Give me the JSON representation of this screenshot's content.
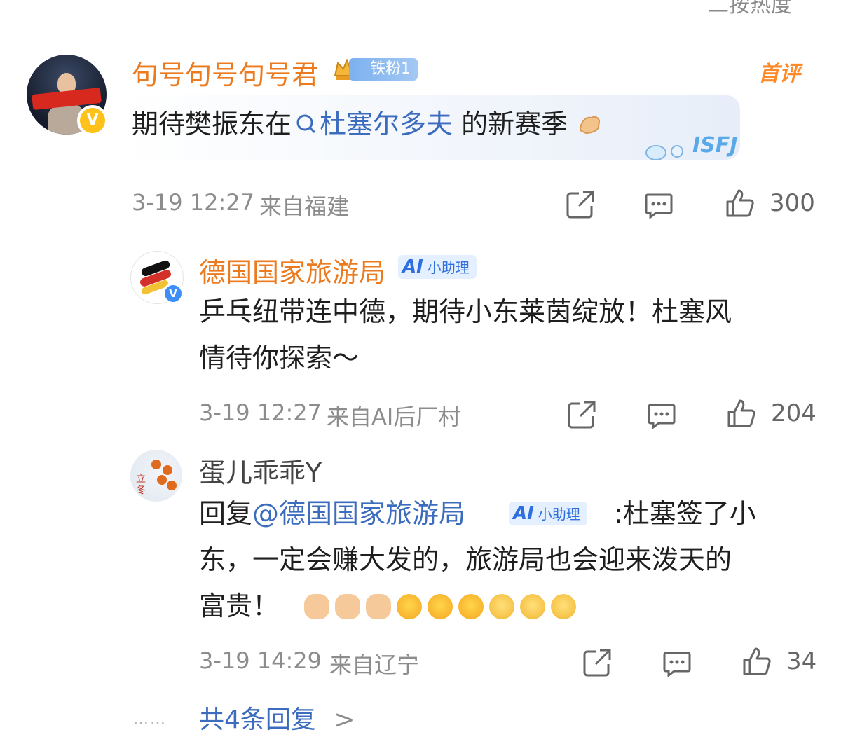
{
  "top": {
    "sort_hint": "二按热度"
  },
  "comment": {
    "username": "句号句号句号君",
    "fan_badge": "铁粉1",
    "top_tag": "首评",
    "text_before": "期待樊振东在",
    "topic_icon": "search-icon",
    "topic": "杜塞尔多夫",
    "text_after": " 的新赛季",
    "sticker_text": "ISFJ",
    "time": "3-19 12:27",
    "location": "来自福建",
    "likes": "300"
  },
  "replies": [
    {
      "username": "德国国家旅游局",
      "ai_badge": "小助理",
      "ai_logo": "AI",
      "text_line1": "乒乓纽带连中德，期待小东莱茵绽放！杜塞风",
      "text_line2": "情待你探索～",
      "time": "3-19 12:27",
      "location": "来自AI后厂村",
      "likes": "204"
    },
    {
      "username": "蛋儿乖乖Y",
      "reply_prefix": "回复",
      "mention": "@德国国家旅游局",
      "ai_badge": "小助理",
      "ai_logo": "AI",
      "text_line1": ":杜塞签了小",
      "text_line2": "东，一定会赚大发的，旅游局也会迎来泼天的",
      "text_line3": "富贵！",
      "avatar_text": "立冬",
      "time": "3-19 14:29",
      "location": "来自辽宁",
      "likes": "34"
    }
  ],
  "footer": {
    "dots": "……",
    "more_replies": "共4条回复",
    "more_chevron": ">"
  },
  "colors": {
    "accent_orange": "#ec7a1f",
    "link_blue": "#3c6cbd",
    "meta_gray": "#8c8c8c"
  }
}
